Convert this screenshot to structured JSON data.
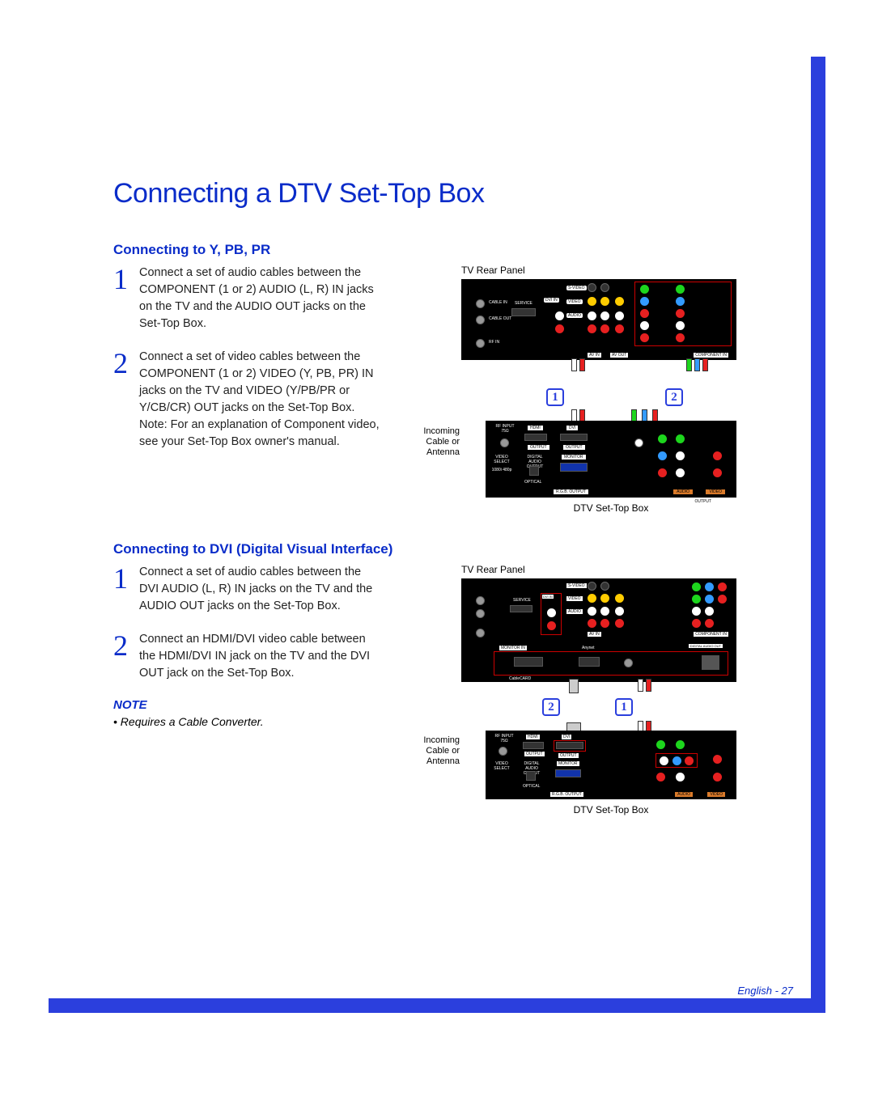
{
  "page": {
    "title": "Connecting a DTV Set-Top Box",
    "footer": "English - 27"
  },
  "section1": {
    "heading": "Connecting to Y, PB, PR",
    "steps": [
      {
        "num": "1",
        "text": "Connect a set of audio cables between the COMPONENT (1 or 2) AUDIO (L, R) IN jacks on the TV and the AUDIO OUT jacks on the Set-Top Box."
      },
      {
        "num": "2",
        "text": "Connect a set of video cables between the COMPONENT (1 or 2) VIDEO (Y, PB, PR) IN jacks on the TV and VIDEO (Y/PB/PR or Y/CB/CR) OUT jacks on the Set-Top Box. Note: For an explanation of Component video, see your Set-Top Box owner's manual."
      }
    ]
  },
  "section2": {
    "heading": "Connecting to DVI (Digital Visual Interface)",
    "steps": [
      {
        "num": "1",
        "text": "Connect a set of audio cables between the DVI AUDIO (L, R) IN jacks on the TV and the AUDIO OUT jacks on the Set-Top Box."
      },
      {
        "num": "2",
        "text": "Connect an HDMI/DVI video cable between the HDMI/DVI IN jack on the TV and the DVI OUT jack on the Set-Top Box."
      }
    ],
    "note_head": "NOTE",
    "note_text": "• Requires a Cable Converter."
  },
  "labels": {
    "tv_rear_panel": "TV Rear Panel",
    "dtv_settop": "DTV Set-Top Box",
    "incoming": "Incoming\nCable or\nAntenna"
  },
  "callouts": {
    "one": "1",
    "two": "2"
  },
  "panel_text": {
    "svideo": "S-VIDEO",
    "video": "VIDEO",
    "audio": "AUDIO",
    "avin": "AV IN",
    "avout": "AV OUT",
    "component": "COMPONENT IN",
    "cablein": "CABLE IN",
    "cableout": "CABLE OUT",
    "rfin": "RF IN",
    "service": "SERVICE",
    "dviin": "DVI IN",
    "rfinput": "RF INPUT 75Ω",
    "hdmi": "HDMI",
    "dvi": "DVI",
    "output": "OUTPUT",
    "monitor": "MONITOR",
    "rgb": "R.G.B. OUTPUT",
    "videoselect": "VIDEO SELECT",
    "digital": "DIGITAL AUDIO OUTPUT",
    "optical": "OPTICAL",
    "res": "1080i 480p",
    "monitorin": "MONITOR IN",
    "anynet": "Anynet",
    "cablecard": "CableCARD",
    "digicard": "DIGITAL AUDIO OUT"
  }
}
